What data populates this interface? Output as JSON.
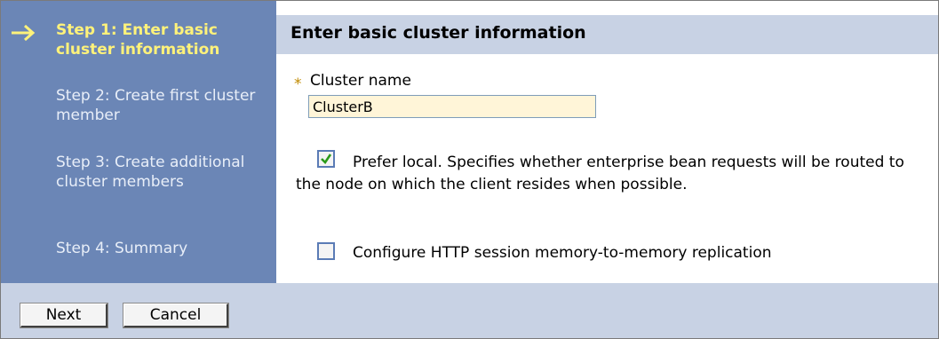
{
  "sidebar": {
    "steps": [
      {
        "label": "Step 1: Enter basic cluster information"
      },
      {
        "label": "Step 2: Create first cluster member"
      },
      {
        "label": "Step 3: Create additional cluster members"
      },
      {
        "label": "Step 4: Summary"
      }
    ],
    "active_icon": "arrow-right-icon"
  },
  "content": {
    "title": "Enter basic cluster information",
    "required_marker": "*",
    "cluster_name_label": "Cluster name",
    "cluster_name_value": "ClusterB",
    "prefer_local": {
      "checked": true,
      "text": "Prefer local. Specifies whether enterprise bean requests will be routed to the node on which the client resides when possible."
    },
    "http_replication": {
      "checked": false,
      "text": "Configure HTTP session memory-to-memory replication"
    }
  },
  "footer": {
    "next_label": "Next",
    "cancel_label": "Cancel"
  },
  "colors": {
    "sidebar_bg": "#6b86b6",
    "header_bg": "#c8d2e4",
    "active_step": "#fff27a",
    "input_bg": "#fff5d8"
  }
}
